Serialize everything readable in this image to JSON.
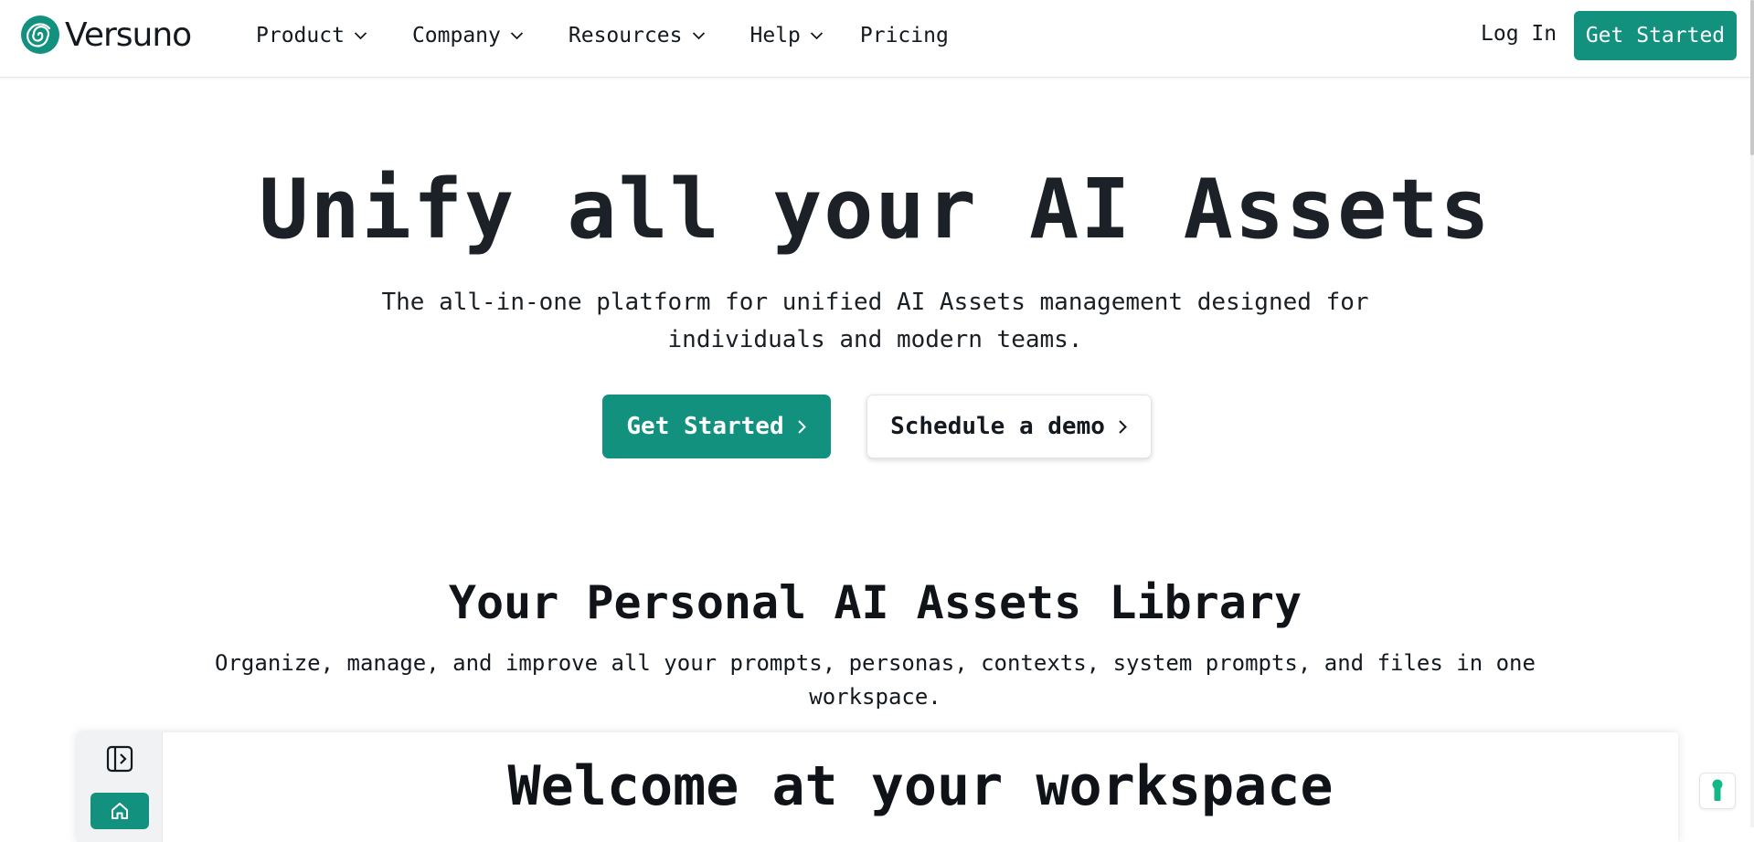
{
  "brand": {
    "name": "Versuno",
    "accent_color": "#12917f"
  },
  "nav": {
    "items": [
      {
        "label": "Product",
        "icon": "chevron-down-icon"
      },
      {
        "label": "Company",
        "icon": "chevron-down-icon"
      },
      {
        "label": "Resources",
        "icon": "chevron-down-icon"
      },
      {
        "label": "Help",
        "icon": "chevron-down-icon"
      },
      {
        "label": "Pricing"
      }
    ],
    "login_label": "Log In",
    "cta_label": "Get Started"
  },
  "hero": {
    "title": "Unify all your AI Assets",
    "subtitle": "The all-in-one platform for unified AI Assets management designed for individuals and modern teams.",
    "primary_cta": "Get Started",
    "secondary_cta": "Schedule a demo"
  },
  "library": {
    "title": "Your Personal AI Assets Library",
    "subtitle": "Organize, manage, and improve all your prompts, personas, contexts, system prompts, and files in one workspace."
  },
  "preview": {
    "title": "Welcome at your workspace",
    "sidebar_icons": [
      "sidebar-toggle-icon",
      "home-icon"
    ]
  },
  "helper": {
    "icon": "keyhole-icon"
  }
}
